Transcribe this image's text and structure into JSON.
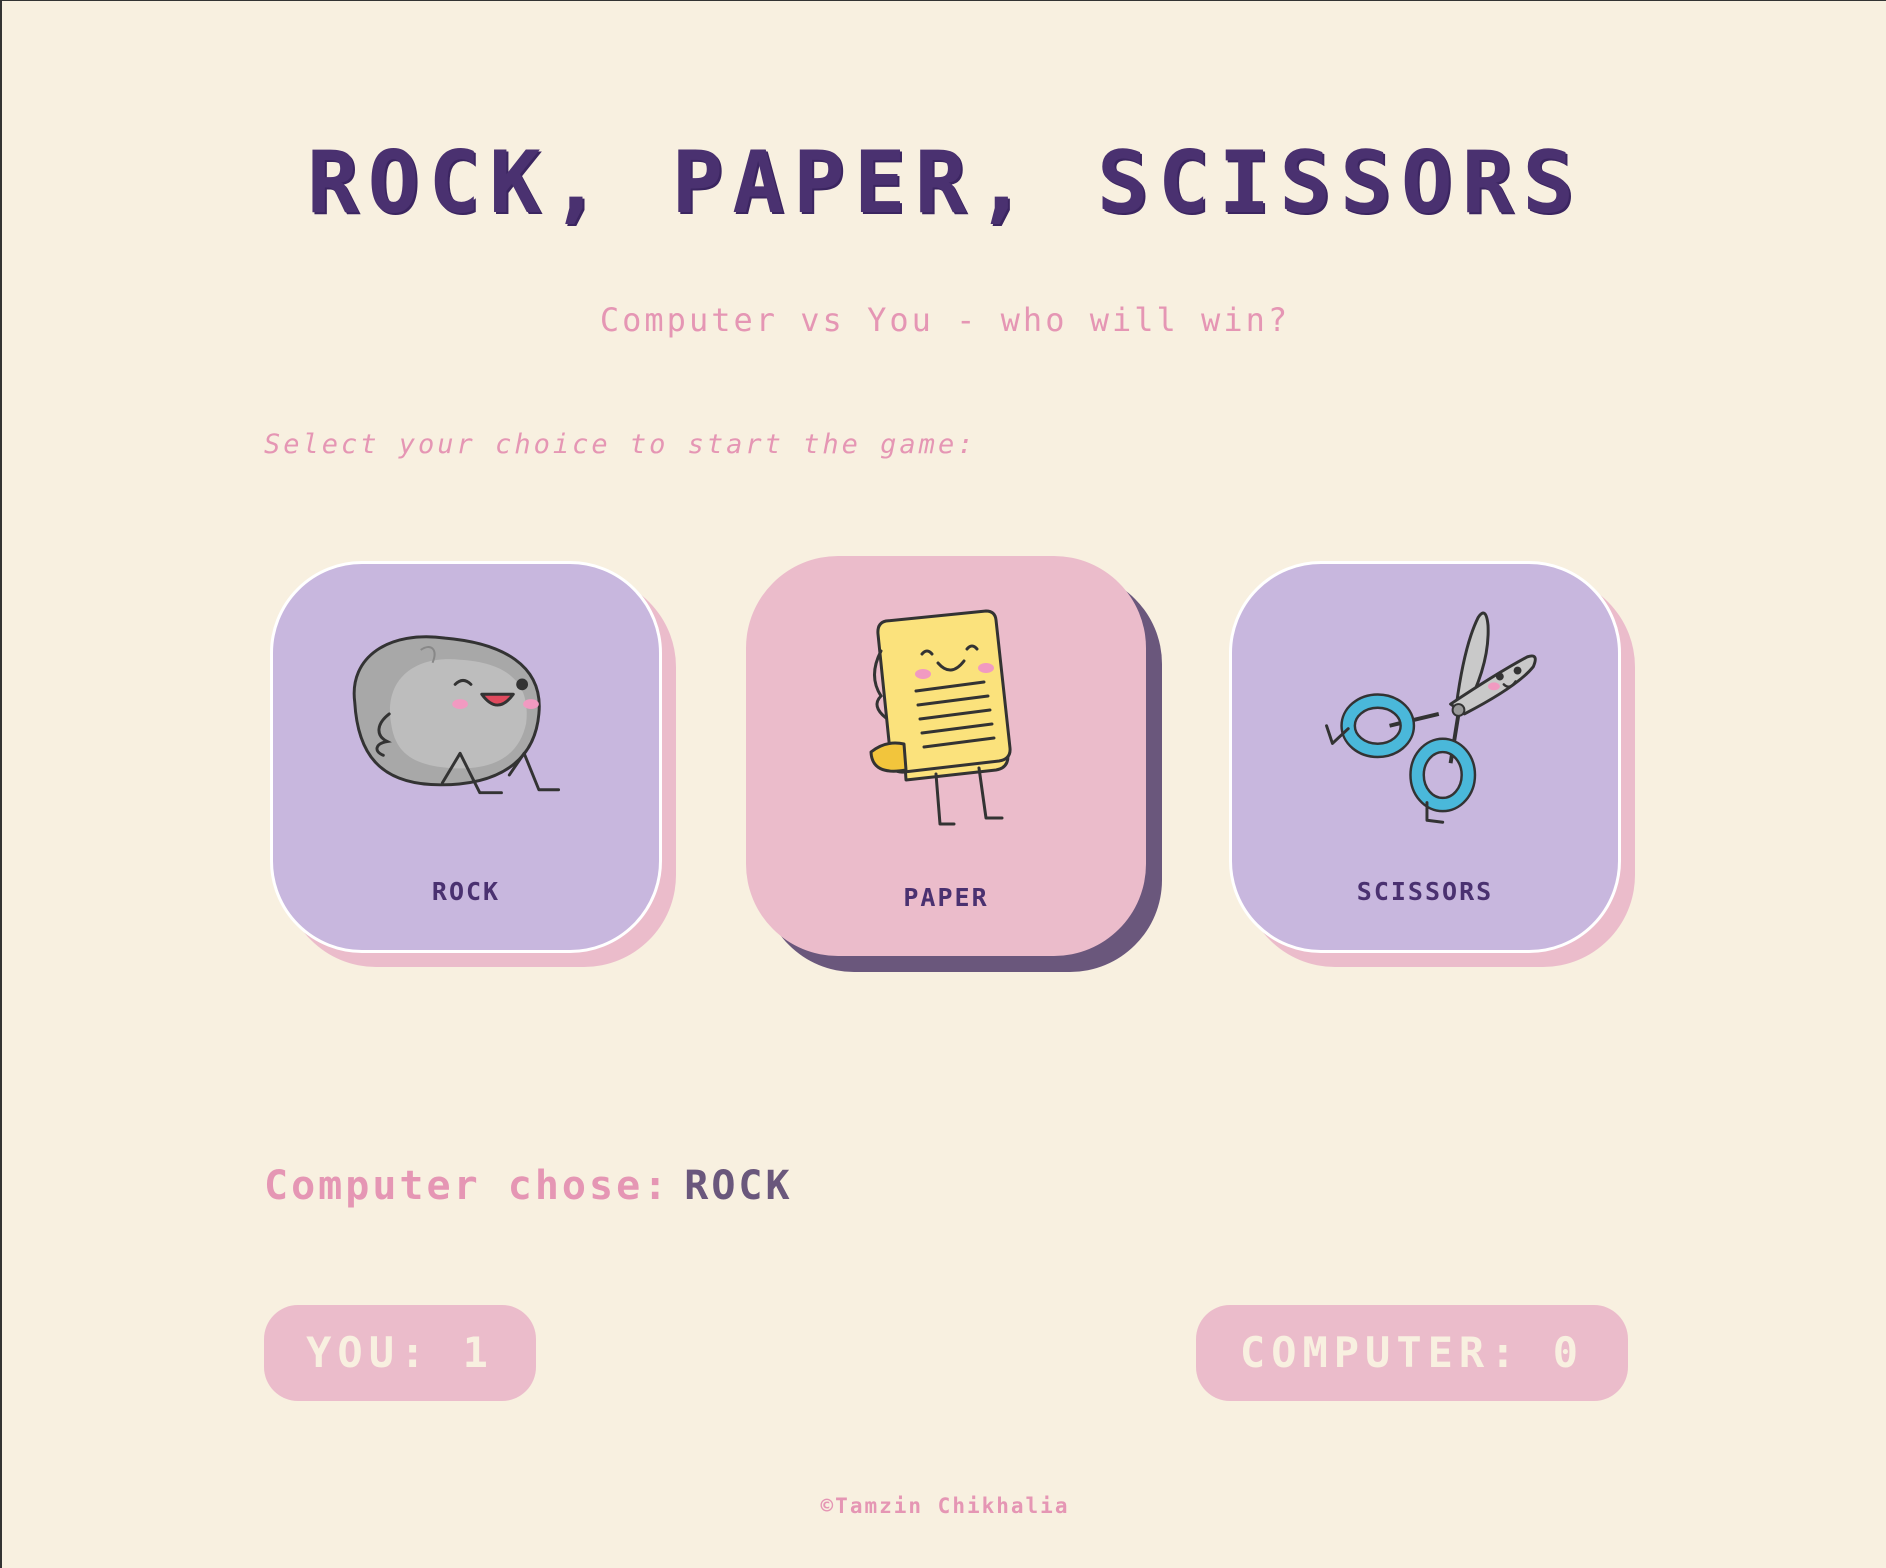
{
  "header": {
    "title": "ROCK, PAPER, SCISSORS",
    "subtitle": "Computer vs You - who will win?"
  },
  "instruction": "Select your choice to start the game:",
  "choices": [
    {
      "label": "ROCK",
      "icon": "rock-character-icon",
      "color": "#c8b7de",
      "selected": false
    },
    {
      "label": "PAPER",
      "icon": "paper-character-icon",
      "color": "#ebbccb",
      "selected": true
    },
    {
      "label": "SCISSORS",
      "icon": "scissors-character-icon",
      "color": "#c8b7de",
      "selected": false
    }
  ],
  "result": {
    "label": "Computer chose:",
    "value": "ROCK"
  },
  "scores": {
    "you_label": "YOU:",
    "you_value": "1",
    "computer_label": "COMPUTER:",
    "computer_value": "0"
  },
  "footer": "©Tamzin Chikhalia",
  "colors": {
    "background": "#f8f0e0",
    "primary": "#4a3170",
    "accent_pink": "#e596b4",
    "card_lavender": "#c8b7de",
    "card_pink": "#ebbccb",
    "shadow_dark": "#6a577c"
  }
}
